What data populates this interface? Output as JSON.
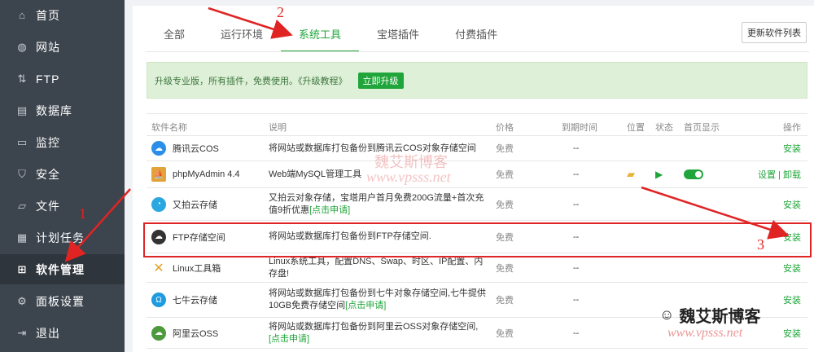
{
  "sidebar": {
    "items": [
      {
        "label": "首页",
        "icon": "home-icon"
      },
      {
        "label": "网站",
        "icon": "globe-icon"
      },
      {
        "label": "FTP",
        "icon": "ftp-icon"
      },
      {
        "label": "数据库",
        "icon": "database-icon"
      },
      {
        "label": "监控",
        "icon": "monitor-icon"
      },
      {
        "label": "安全",
        "icon": "shield-icon"
      },
      {
        "label": "文件",
        "icon": "folder-icon"
      },
      {
        "label": "计划任务",
        "icon": "calendar-icon"
      },
      {
        "label": "软件管理",
        "icon": "grid-icon"
      },
      {
        "label": "面板设置",
        "icon": "gear-icon"
      },
      {
        "label": "退出",
        "icon": "logout-icon"
      }
    ]
  },
  "tabs": [
    "全部",
    "运行环境",
    "系统工具",
    "宝塔插件",
    "付费插件"
  ],
  "refresh_label": "更新软件列表",
  "promo": {
    "text": "升级专业版，所有插件，免费使用。《升级教程》",
    "button": "立即升级"
  },
  "table": {
    "headers": [
      "软件名称",
      "说明",
      "价格",
      "到期时间",
      "位置",
      "状态",
      "首页显示",
      "操作"
    ],
    "rows": [
      {
        "name": "腾讯云COS",
        "desc": "将网站或数据库打包备份到腾讯云COS对象存储空间",
        "desc_link": "",
        "price": "免费",
        "expire": "--",
        "op": "安装",
        "icon": "tencent-cloud-icon",
        "color": "#2b8ee8"
      },
      {
        "name": "phpMyAdmin 4.4",
        "desc": "Web端MySQL管理工具",
        "desc_link": "",
        "price": "免费",
        "expire": "--",
        "op": "设置 | 卸载",
        "icon": "phpmyadmin-icon",
        "color": "#e2a33a"
      },
      {
        "name": "又拍云存储",
        "desc": "又拍云对象存储，宝塔用户首月免费200G流量+首次充值9折优惠",
        "desc_link": "[点击申请]",
        "price": "免费",
        "expire": "--",
        "op": "安装",
        "icon": "upyun-icon",
        "color": "#2aa7e0"
      },
      {
        "name": "FTP存储空间",
        "desc": "将网站或数据库打包备份到FTP存储空间.",
        "desc_link": "",
        "price": "免费",
        "expire": "--",
        "op": "安装",
        "icon": "ftp-cloud-icon",
        "color": "#333333"
      },
      {
        "name": "Linux工具箱",
        "desc": "Linux系统工具，配置DNS、Swap、时区、IP配置、内存盘!",
        "desc_link": "",
        "price": "免费",
        "expire": "--",
        "op": "安装",
        "icon": "tools-icon",
        "color": "#e8a321"
      },
      {
        "name": "七牛云存储",
        "desc": "将网站或数据库打包备份到七牛对象存储空间,七牛提供10GB免费存储空间",
        "desc_link": "[点击申请]",
        "price": "免费",
        "expire": "--",
        "op": "安装",
        "icon": "qiniu-icon",
        "color": "#1f9be0"
      },
      {
        "name": "阿里云OSS",
        "desc": "将网站或数据库打包备份到阿里云OSS对象存储空间,",
        "desc_link": "[点击申请]",
        "price": "免费",
        "expire": "--",
        "op": "安装",
        "icon": "aliyun-icon",
        "color": "#4c9a3c"
      }
    ]
  },
  "annotations": {
    "a1": "1",
    "a2": "2",
    "a3": "3"
  },
  "watermark": {
    "center_text": "魏艾斯博客",
    "center_url": "www.vpsss.net",
    "brand": "魏艾斯博客",
    "url": "www.vpsss.net"
  },
  "colors": {
    "accent": "#20a53a",
    "sidebar": "#3c444d",
    "annotation": "#e02424"
  }
}
